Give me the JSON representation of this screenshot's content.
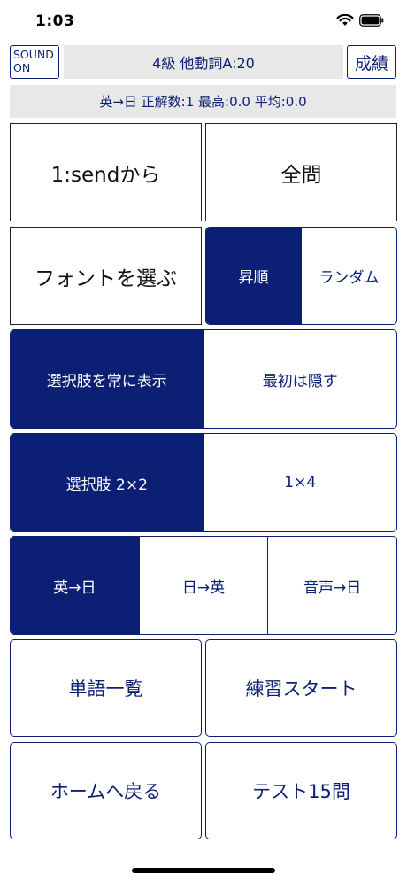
{
  "status_bar": {
    "time": "1:03"
  },
  "top": {
    "sound_line1": "SOUND",
    "sound_line2": "ON",
    "title": "4級 他動詞A:20",
    "score_button": "成績"
  },
  "stats": "英→日 正解数:1 最高:0.0 平均:0.0",
  "row1": {
    "start_from": "1:sendから",
    "all_questions": "全問"
  },
  "row2": {
    "font_select": "フォントを選ぶ",
    "order_asc": "昇順",
    "order_random": "ランダム"
  },
  "choices_display": {
    "always_show": "選択肢を常に表示",
    "hide_first": "最初は隠す"
  },
  "choices_layout": {
    "grid": "選択肢 2×2",
    "list": "1×4"
  },
  "direction": {
    "en_ja": "英→日",
    "ja_en": "日→英",
    "audio_ja": "音声→日"
  },
  "actions": {
    "word_list": "単語一覧",
    "practice_start": "練習スタート",
    "back_home": "ホームへ戻る",
    "test": "テスト15問"
  },
  "colors": {
    "accent": "#0b1f74",
    "panel": "#e8e8e8"
  },
  "icons": [
    "wifi-icon",
    "battery-icon"
  ]
}
